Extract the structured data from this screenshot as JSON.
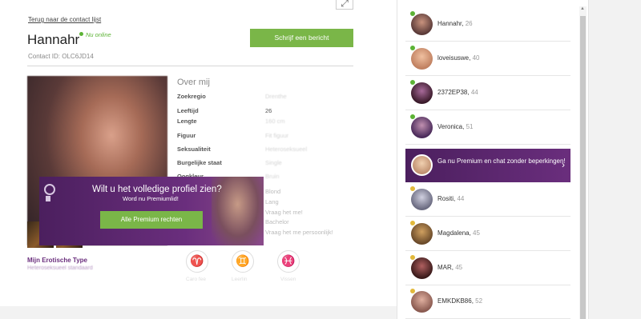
{
  "corner_button": {
    "glyph": "⤢"
  },
  "profile": {
    "back_link": "Terug naar de contact lijst",
    "name": "Hannahr",
    "status": "Nu online",
    "contact_id": "Contact ID: OLC6JD14",
    "write_button": "Schrijf een bericht"
  },
  "about": {
    "title": "Over mij",
    "rows": [
      {
        "label": "Zoekregio",
        "value": "Drenthe"
      },
      {
        "label": "Leeftijd",
        "value": "26"
      },
      {
        "label": "Lengte",
        "value": "160 cm"
      },
      {
        "label": "Figuur",
        "value": "Fit figuur"
      },
      {
        "label": "Seksualiteit",
        "value": "Heteroseksueel"
      },
      {
        "label": "Burgelijke staat",
        "value": "Single"
      },
      {
        "label": "Oogkleur",
        "value": "Bruin"
      },
      {
        "label": "",
        "value": "Blond"
      },
      {
        "label": "",
        "value": "Lang"
      },
      {
        "label": "",
        "value": "Vraag het me!"
      },
      {
        "label": "",
        "value": "Bachelor"
      },
      {
        "label": "",
        "value": "Vraag het me persoonlijk!"
      }
    ]
  },
  "premium_overlay": {
    "title": "Wilt u het volledige profiel zien?",
    "subtitle": "Word nu Premiumlid!",
    "button": "Alle Premium rechten"
  },
  "erotic": {
    "title": "Mijn Erotische Type",
    "subtitle": "Heteroseksueel standaard"
  },
  "signs": [
    {
      "glyph": "♈",
      "label": "Caro fee"
    },
    {
      "glyph": "♊",
      "label": "Leerlin"
    },
    {
      "glyph": "♓",
      "label": "Vissen"
    }
  ],
  "sidebar": {
    "contacts": [
      {
        "name": "Hannahr",
        "age": "26",
        "status": "green"
      },
      {
        "name": "loveisuswe",
        "age": "40",
        "status": "green"
      },
      {
        "name": "2372EP38",
        "age": "44",
        "status": "green"
      },
      {
        "name": "Veronica",
        "age": "51",
        "status": "green"
      },
      {
        "name": "Rositi",
        "age": "44",
        "status": "yellow"
      },
      {
        "name": "Magdalena",
        "age": "45",
        "status": "yellow"
      },
      {
        "name": "MAR",
        "age": "45",
        "status": "yellow"
      },
      {
        "name": "EMKDKB86",
        "age": "52",
        "status": "yellow"
      }
    ],
    "promo": {
      "text": "Ga nu Premium en chat zonder beperkingen!"
    }
  },
  "colors": {
    "accent_green": "#7ab648",
    "online": "#5cb335",
    "away": "#e2b93b",
    "premium_purple": "#6a2e7d"
  }
}
